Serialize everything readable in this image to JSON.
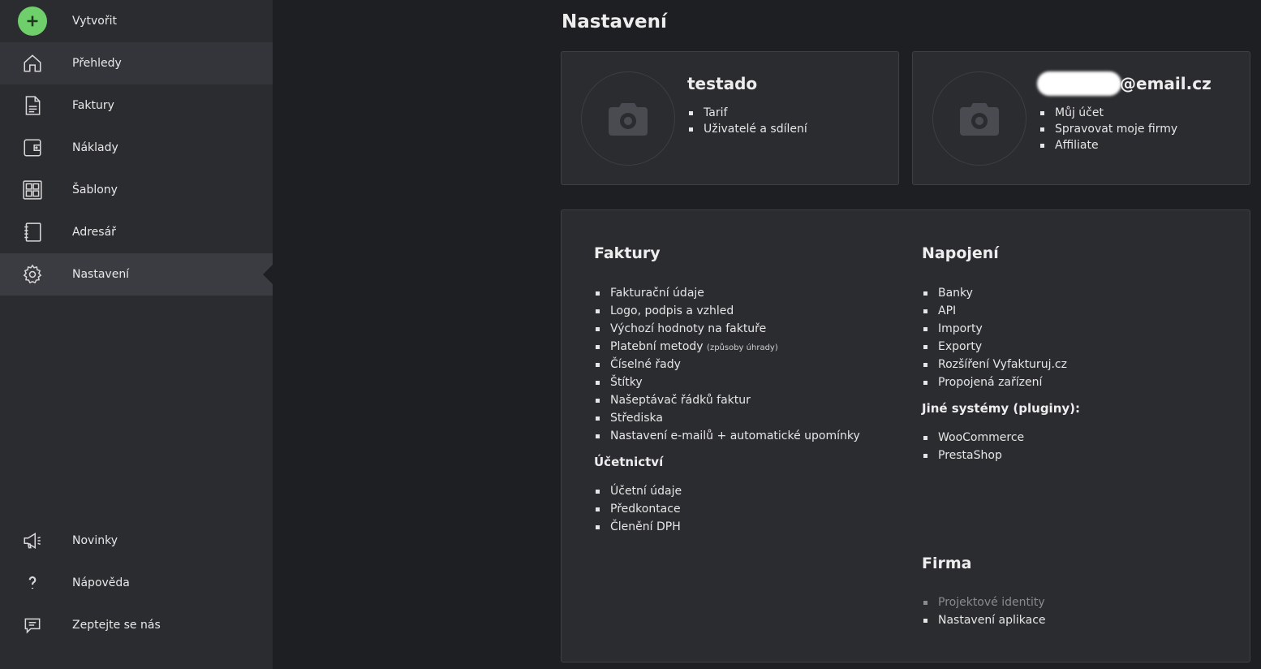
{
  "sidebar": {
    "create_label": "Vytvořit",
    "items": [
      {
        "label": "Přehledy",
        "icon": "home-icon"
      },
      {
        "label": "Faktury",
        "icon": "document-icon"
      },
      {
        "label": "Náklady",
        "icon": "wallet-icon"
      },
      {
        "label": "Šablony",
        "icon": "templates-icon"
      },
      {
        "label": "Adresář",
        "icon": "address-book-icon"
      },
      {
        "label": "Nastavení",
        "icon": "gear-icon"
      }
    ],
    "bottom_items": [
      {
        "label": "Novinky",
        "icon": "megaphone-icon"
      },
      {
        "label": "Nápověda",
        "icon": "question-icon"
      },
      {
        "label": "Zeptejte se nás",
        "icon": "chat-icon"
      }
    ],
    "active_item": "Nastavení"
  },
  "page": {
    "title": "Nastavení"
  },
  "company_card": {
    "name": "testado",
    "links": [
      "Tarif",
      "Uživatelé a sdílení"
    ]
  },
  "account_card": {
    "email_suffix": "@email.cz",
    "links": [
      "Můj účet",
      "Spravovat moje firmy",
      "Affiliate"
    ]
  },
  "settings": {
    "faktury": {
      "title": "Faktury",
      "links": [
        "Fakturační údaje",
        "Logo, podpis a vzhled",
        "Výchozí hodnoty na faktuře",
        "Platební metody",
        "Číselné řady",
        "Štítky",
        "Našeptávač řádků faktur",
        "Střediska",
        "Nastavení e-mailů + automatické upomínky"
      ],
      "payment_note": "(způsoby úhrady)"
    },
    "ucetnictvi": {
      "title": "Účetnictví",
      "links": [
        "Účetní údaje",
        "Předkontace",
        "Členění DPH"
      ]
    },
    "napojeni": {
      "title": "Napojení",
      "links": [
        "Banky",
        "API",
        "Importy",
        "Exporty",
        "Rozšíření Vyfakturuj.cz",
        "Propojená zařízení"
      ]
    },
    "jine_systemy": {
      "title": "Jiné systémy (pluginy):",
      "links": [
        "WooCommerce",
        "PrestaShop"
      ]
    },
    "firma": {
      "title": "Firma",
      "links": [
        "Projektové identity",
        "Nastavení aplikace"
      ]
    }
  }
}
